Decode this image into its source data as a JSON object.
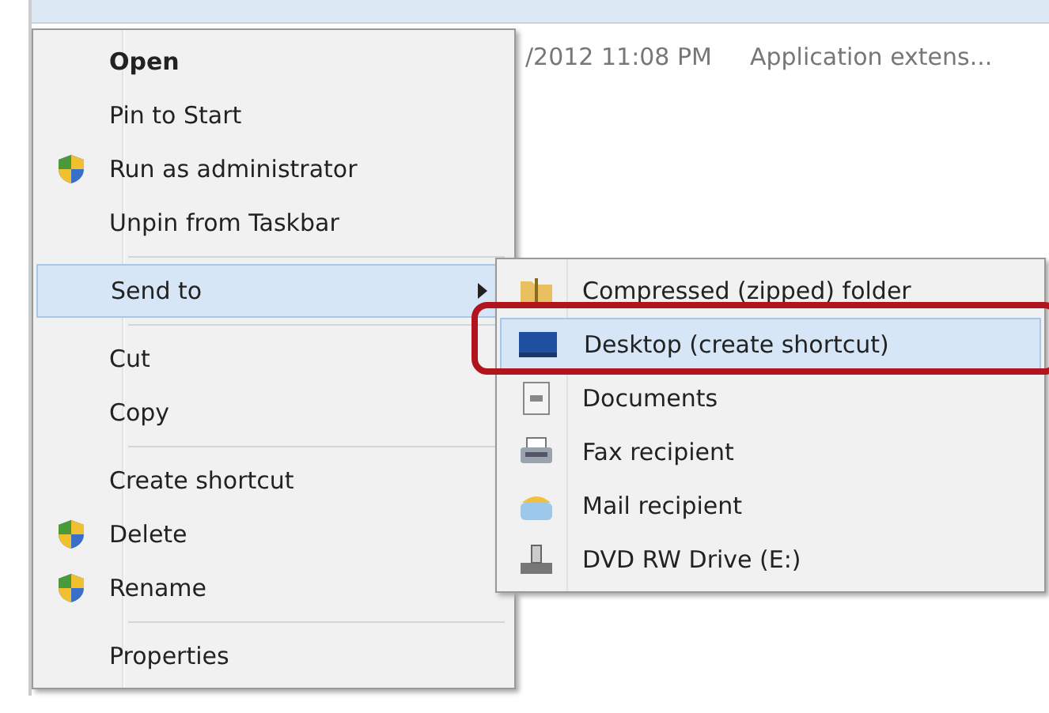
{
  "file_list": {
    "rows": [
      {
        "date": "/2012 11:08 PM",
        "type": "Application extens..."
      }
    ]
  },
  "context_menu": {
    "items": [
      {
        "kind": "item",
        "label": "Open",
        "bold": true,
        "shield": false,
        "selected": false,
        "submenu": false
      },
      {
        "kind": "item",
        "label": "Pin to Start",
        "bold": false,
        "shield": false,
        "selected": false,
        "submenu": false
      },
      {
        "kind": "item",
        "label": "Run as administrator",
        "bold": false,
        "shield": true,
        "selected": false,
        "submenu": false
      },
      {
        "kind": "item",
        "label": "Unpin from Taskbar",
        "bold": false,
        "shield": false,
        "selected": false,
        "submenu": false
      },
      {
        "kind": "separator"
      },
      {
        "kind": "item",
        "label": "Send to",
        "bold": false,
        "shield": false,
        "selected": true,
        "submenu": true
      },
      {
        "kind": "separator"
      },
      {
        "kind": "item",
        "label": "Cut",
        "bold": false,
        "shield": false,
        "selected": false,
        "submenu": false
      },
      {
        "kind": "item",
        "label": "Copy",
        "bold": false,
        "shield": false,
        "selected": false,
        "submenu": false
      },
      {
        "kind": "separator"
      },
      {
        "kind": "item",
        "label": "Create shortcut",
        "bold": false,
        "shield": false,
        "selected": false,
        "submenu": false
      },
      {
        "kind": "item",
        "label": "Delete",
        "bold": false,
        "shield": true,
        "selected": false,
        "submenu": false
      },
      {
        "kind": "item",
        "label": "Rename",
        "bold": false,
        "shield": true,
        "selected": false,
        "submenu": false
      },
      {
        "kind": "separator"
      },
      {
        "kind": "item",
        "label": "Properties",
        "bold": false,
        "shield": false,
        "selected": false,
        "submenu": false
      }
    ]
  },
  "send_to_menu": {
    "items": [
      {
        "kind": "zip",
        "label": "Compressed (zipped) folder",
        "selected": false,
        "highlighted_by_callout": false
      },
      {
        "kind": "desktop",
        "label": "Desktop (create shortcut)",
        "selected": true,
        "highlighted_by_callout": true
      },
      {
        "kind": "documents",
        "label": "Documents",
        "selected": false,
        "highlighted_by_callout": false
      },
      {
        "kind": "fax",
        "label": "Fax recipient",
        "selected": false,
        "highlighted_by_callout": false
      },
      {
        "kind": "mail",
        "label": "Mail recipient",
        "selected": false,
        "highlighted_by_callout": false
      },
      {
        "kind": "dvd",
        "label": "DVD RW Drive (E:)",
        "selected": false,
        "highlighted_by_callout": false
      }
    ]
  }
}
